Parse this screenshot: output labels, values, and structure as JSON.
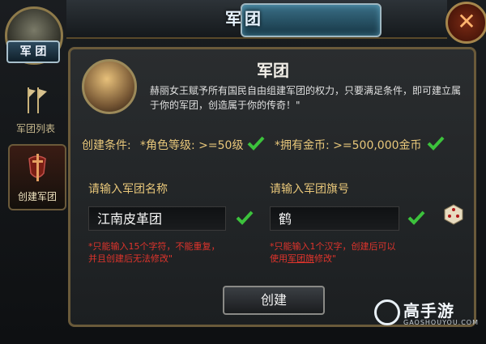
{
  "header": {
    "title": "军团",
    "close_icon": "close-icon"
  },
  "emblem": {
    "label": "军 团"
  },
  "sidebar": {
    "items": [
      {
        "label": "军团列表",
        "icon": "flags-icon",
        "active": false
      },
      {
        "label": "创建军团",
        "icon": "sword-shield-icon",
        "active": true
      }
    ]
  },
  "panel": {
    "title": "军团",
    "description": "赫丽女王赋予所有国民自由组建军团的权力，只要满足条件，即可建立属于你的军团，创造属于你的传奇！\"",
    "conditions": {
      "label": "创建条件:",
      "level": "*角色等级: >=50级",
      "gold": "*拥有金币: >=500,000金币"
    },
    "name_field": {
      "label": "请输入军团名称",
      "value": "江南皮革团",
      "hint_line1": "*只能输入15个字符，不能重复，",
      "hint_line2": "并且创建后无法修改\""
    },
    "flag_field": {
      "label": "请输入军团旗号",
      "value": "鹤",
      "hint_line1": "*只能输入1个汉字，创建后可以",
      "hint_line2a": "使用",
      "hint_line2b": "军团旗",
      "hint_line2c": "修改\""
    },
    "create_button": "创建"
  },
  "watermark": {
    "brand": "高手游",
    "url": "GAOSHOUYOU.COM"
  },
  "colors": {
    "accent_gold": "#e8c77a",
    "hint_red": "#e0342c",
    "check_green": "#3cc23c"
  }
}
